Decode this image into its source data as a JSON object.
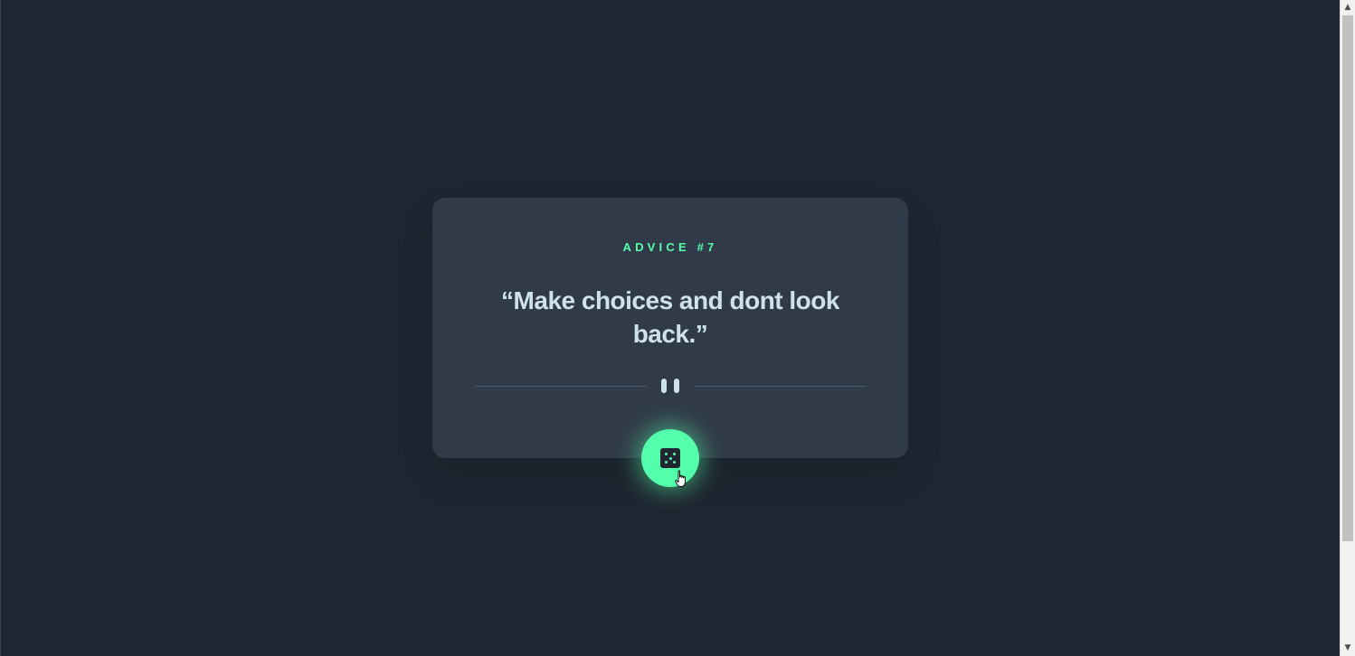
{
  "card": {
    "advice_id": "ADVICE #7",
    "quote": "“Make choices and dont look back.”"
  },
  "icons": {
    "divider": "pause-icon",
    "button": "dice-icon",
    "cursor": "hand-pointer-cursor"
  },
  "colors": {
    "background": "#1f2631",
    "card": "#313a48",
    "accent": "#53ffaa",
    "text": "#cee3e9",
    "divider": "#4f5d74"
  }
}
